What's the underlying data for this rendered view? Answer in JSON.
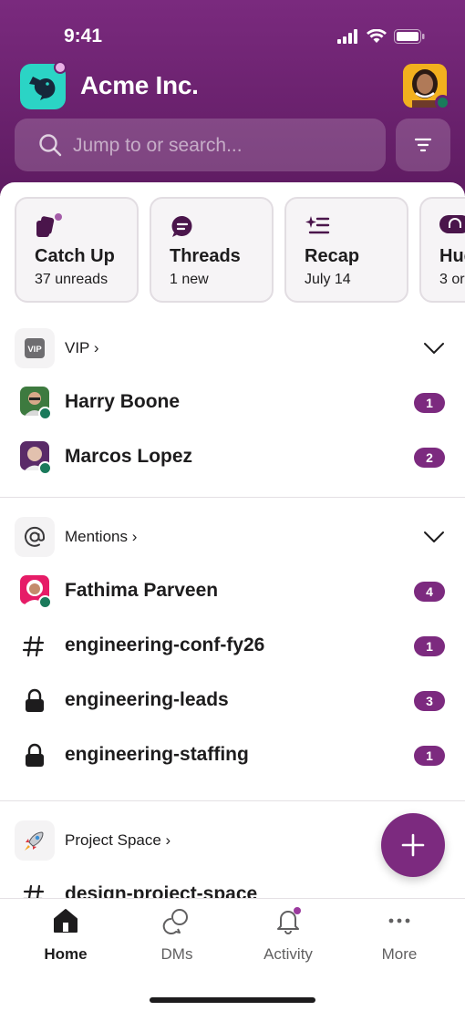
{
  "status_bar": {
    "time": "9:41"
  },
  "workspace": {
    "name": "Acme Inc."
  },
  "search": {
    "placeholder": "Jump to or search..."
  },
  "cards": [
    {
      "title": "Catch Up",
      "subtitle": "37 unreads",
      "icon": "catch-up-icon"
    },
    {
      "title": "Threads",
      "subtitle": "1 new",
      "icon": "threads-icon"
    },
    {
      "title": "Recap",
      "subtitle": "July 14",
      "icon": "recap-icon"
    },
    {
      "title": "Hud",
      "subtitle": "3 or",
      "icon": "huddles-icon"
    }
  ],
  "sections": {
    "vip": {
      "title": "VIP ›",
      "icon_text": "VIP",
      "rows": [
        {
          "name": "Harry Boone",
          "badge": "1"
        },
        {
          "name": "Marcos Lopez",
          "badge": "2"
        }
      ]
    },
    "mentions": {
      "title": "Mentions ›",
      "rows": [
        {
          "name": "Fathima Parveen",
          "badge": "4",
          "type": "dm"
        },
        {
          "name": "engineering-conf-fy26",
          "badge": "1",
          "type": "channel"
        },
        {
          "name": "engineering-leads",
          "badge": "3",
          "type": "private"
        },
        {
          "name": "engineering-staffing",
          "badge": "1",
          "type": "private"
        }
      ]
    },
    "project": {
      "title": "Project Space ›",
      "rows": [
        {
          "name": "design-project-space",
          "type": "channel"
        }
      ]
    }
  },
  "tabs": [
    {
      "label": "Home",
      "active": true,
      "icon": "home-icon"
    },
    {
      "label": "DMs",
      "active": false,
      "icon": "dms-icon"
    },
    {
      "label": "Activity",
      "active": false,
      "icon": "bell-icon"
    },
    {
      "label": "More",
      "active": false,
      "icon": "more-icon"
    }
  ],
  "colors": {
    "header": "#6a2070",
    "accent": "#7c2a7f",
    "presence": "#1a7a5b",
    "logo": "#2bd4c5"
  }
}
